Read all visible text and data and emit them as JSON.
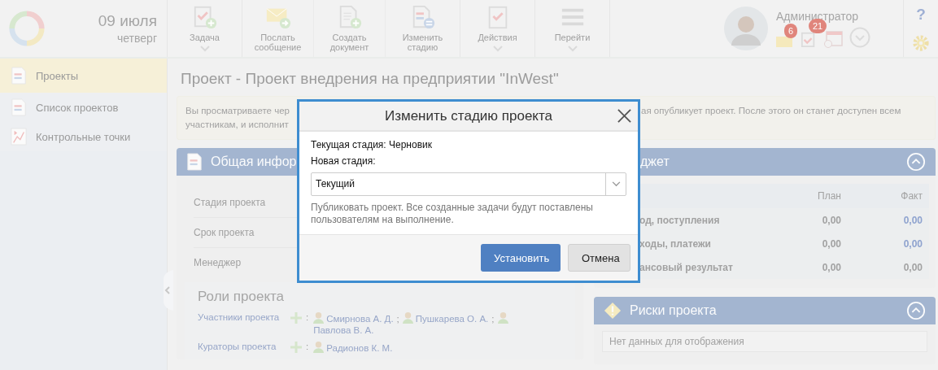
{
  "header": {
    "date": "09 июля",
    "weekday": "четверг"
  },
  "toolbar": [
    {
      "kind": "task",
      "label": "Задача",
      "dropdown": true
    },
    {
      "kind": "message",
      "label": "Послать сообщение",
      "dropdown": false
    },
    {
      "kind": "document",
      "label": "Создать документ",
      "dropdown": false
    },
    {
      "kind": "stage",
      "label": "Изменить стадию",
      "dropdown": false
    },
    {
      "kind": "actions",
      "label": "Действия",
      "dropdown": true
    },
    {
      "kind": "menu",
      "label": "Перейти",
      "dropdown": true
    }
  ],
  "user": {
    "name": "Администратор",
    "mail_count": "6",
    "task_count": "21",
    "help": "?"
  },
  "sidebar": {
    "items": [
      {
        "kind": "document",
        "label": "Проекты",
        "selected": true
      },
      {
        "kind": "document",
        "label": "Список проектов",
        "selected": false
      },
      {
        "kind": "chart",
        "label": "Контрольные точки",
        "selected": false
      }
    ]
  },
  "page_title": "Проект - Проект внедрения на предприятии \"InWest\"",
  "notice": {
    "left_lines": [
      "Вы просматриваете чер",
      "участникам, и исполнит"
    ],
    "right_lines": [
      "ая опубликует проект. После этого он станет доступен всем"
    ]
  },
  "general_panel": {
    "title": "Общая инфор",
    "fields": [
      "Стадия проекта",
      "Срок проекта",
      "Менеджер"
    ]
  },
  "roles": {
    "title": "Роли проекта",
    "groups": [
      {
        "label": "Участники проекта",
        "colon": ":",
        "people": [
          {
            "name": "Смирнова А. Д.",
            "sep": ";"
          },
          {
            "name": "Пушкарева О. А.",
            "sep": ";"
          },
          {
            "name": "Павлова В. А."
          }
        ]
      },
      {
        "label": "Кураторы проекта",
        "colon": ":",
        "people": [
          {
            "name": "Радионов К. М."
          }
        ]
      }
    ]
  },
  "budget": {
    "title": "джет",
    "columns": [
      "План",
      "Факт"
    ],
    "rows": [
      {
        "label": "од, поступления",
        "plan": "0,00",
        "fact": "0,00",
        "fact_link": true
      },
      {
        "label": "ходы, платежи",
        "plan": "0,00",
        "fact": "0,00",
        "fact_link": true
      },
      {
        "label": "ансовый результат",
        "plan": "0,00",
        "fact": "0,00",
        "fact_link": false
      }
    ]
  },
  "risks": {
    "title": "Риски проекта",
    "empty": "Нет данных для отображения"
  },
  "dialog": {
    "title": "Изменить стадию проекта",
    "current": "Текущая стадия: Черновик",
    "new_label": "Новая стадия:",
    "value": "Текущий",
    "hint": "Публиковать проект. Все созданные задачи будут поставлены пользователям на выполнение.",
    "buttons": [
      {
        "kind": "primary",
        "label": "Установить"
      },
      {
        "kind": "secondary",
        "label": "Отмена"
      }
    ]
  }
}
